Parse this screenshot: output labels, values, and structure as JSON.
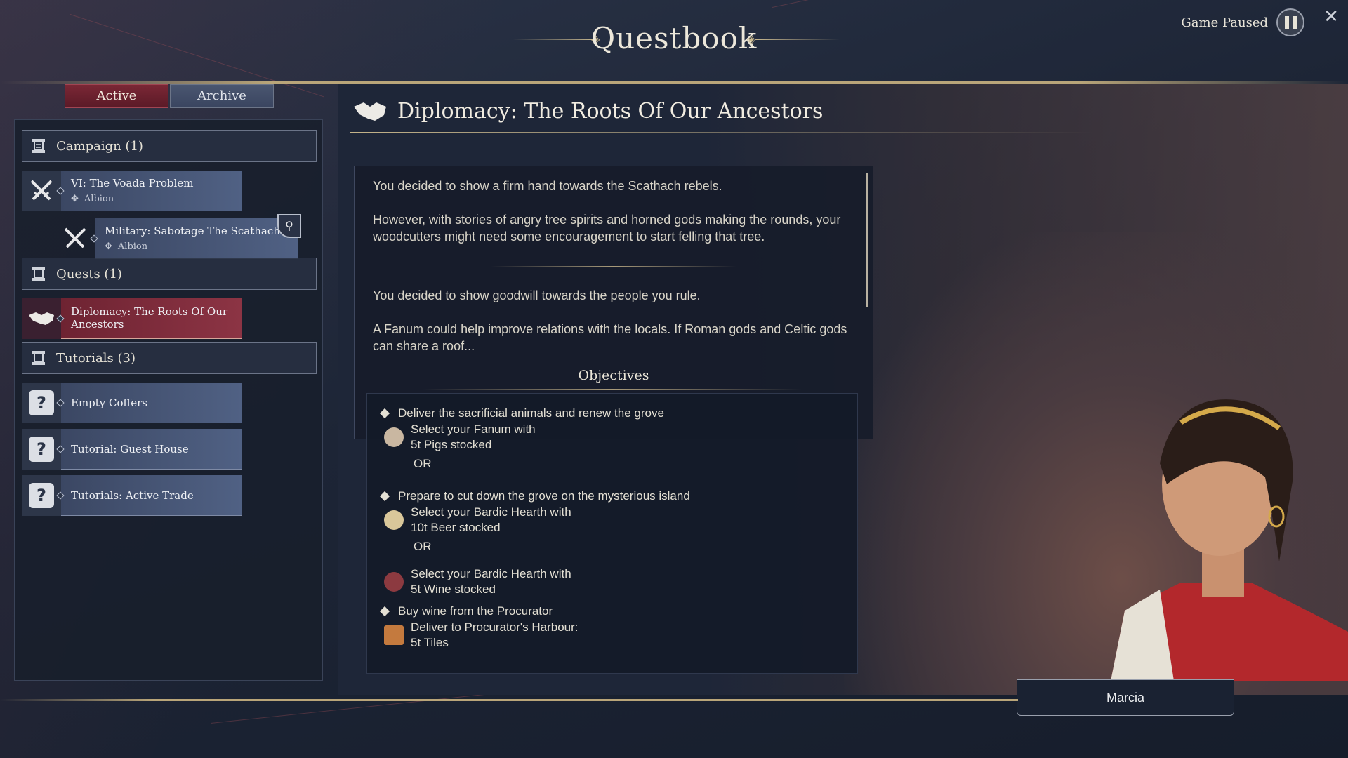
{
  "header": {
    "title": "Questbook",
    "status_label": "Game Paused"
  },
  "tabs": [
    {
      "label": "Active",
      "state": "active"
    },
    {
      "label": "Archive",
      "state": "inactive"
    }
  ],
  "sections": {
    "campaign": {
      "label": "Campaign (1)"
    },
    "quests": {
      "label": "Quests (1)"
    },
    "tutorials": {
      "label": "Tutorials (3)"
    }
  },
  "campaign_items": [
    {
      "title": "VI: The Voada Problem",
      "region": "Albion",
      "icon": "crossed-swords-icon"
    },
    {
      "title": "Military: Sabotage The Scathach",
      "region": "Albion",
      "icon": "crossed-swords-icon"
    }
  ],
  "quest_items": [
    {
      "title": "Diplomacy: The Roots Of Our Ancestors",
      "icon": "handshake-icon",
      "selected": true
    }
  ],
  "tutorial_items": [
    {
      "title": "Empty Coffers",
      "icon": "question-icon"
    },
    {
      "title": "Tutorial: Guest House",
      "icon": "question-icon"
    },
    {
      "title": "Tutorials: Active Trade",
      "icon": "question-icon"
    }
  ],
  "detail": {
    "title": "Diplomacy: The Roots Of Our Ancestors",
    "paragraphs": [
      "You decided to show a firm hand towards the Scathach rebels.",
      "However, with stories of angry tree spirits and horned gods making the rounds, your woodcutters might need some encouragement to start felling that tree.",
      "You decided to show goodwill towards the people you rule.",
      "A Fanum could help improve relations with the locals. If Roman gods and Celtic gods can share a roof..."
    ],
    "objectives_title": "Objectives",
    "objectives": [
      {
        "text": "Deliver the sacrificial animals and renew the grove"
      },
      {
        "text": "Select your Fanum with",
        "text2": "5t Pigs stocked",
        "icon": "pig-icon"
      },
      {
        "text": "OR"
      },
      {
        "text": "Prepare to cut down the grove on the mysterious island"
      },
      {
        "text": "Select your Bardic Hearth with",
        "text2": "10t Beer stocked",
        "icon": "beer-icon"
      },
      {
        "text": "OR"
      },
      {
        "text": "Select your Bardic Hearth with",
        "text2": "5t Wine stocked",
        "icon": "wine-icon"
      },
      {
        "text": "Buy wine from the Procurator"
      },
      {
        "text": "Deliver to Procurator's Harbour:",
        "text2": "5t Tiles",
        "icon": "tiles-icon"
      }
    ]
  },
  "npc": {
    "name": "Marcia"
  },
  "colors": {
    "accent": "#7a2735",
    "gold": "#b9a579",
    "panel": "#1e2638"
  }
}
